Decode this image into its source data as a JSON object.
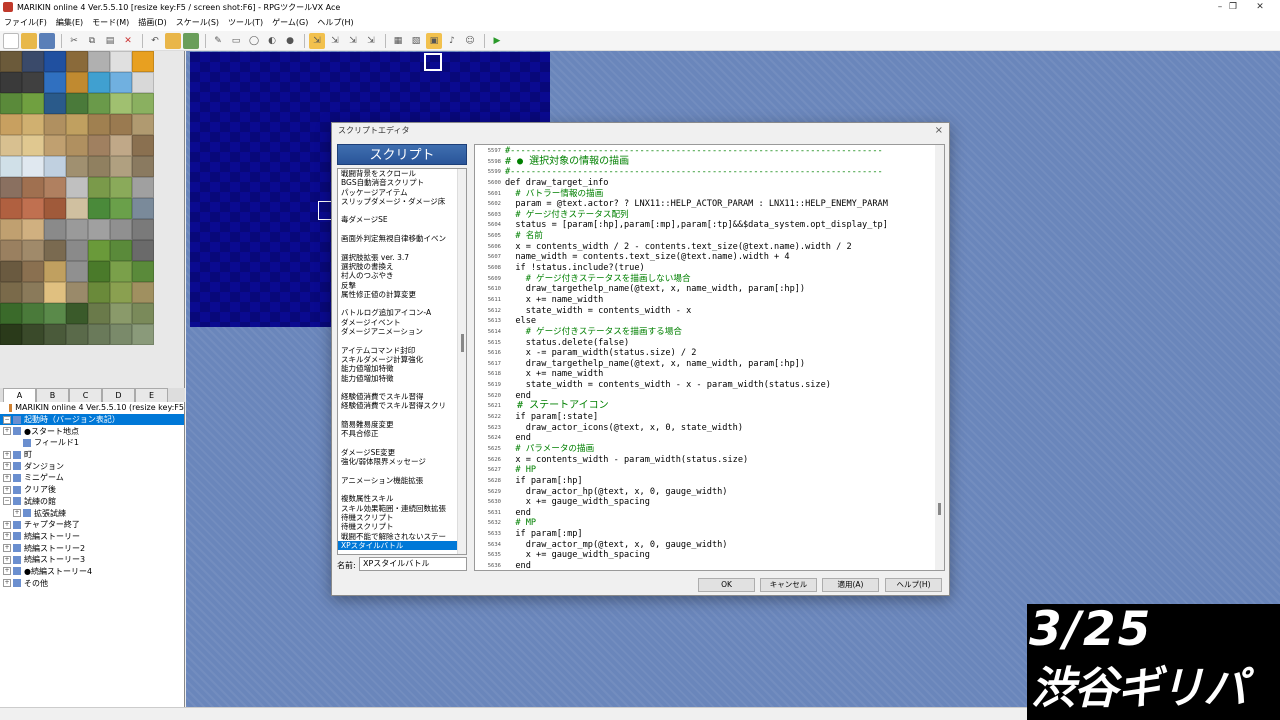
{
  "window": {
    "title": "MARIKIN online 4 Ver.5.5.10 [resize key:F5 / screen shot:F6] - RPGツクールVX Ace",
    "controls": [
      "–",
      "❐",
      "✕"
    ]
  },
  "menu": [
    "ファイル(F)",
    "編集(E)",
    "モード(M)",
    "描画(D)",
    "スケール(S)",
    "ツール(T)",
    "ゲーム(G)",
    "ヘルプ(H)"
  ],
  "map_tabs": [
    "A",
    "B",
    "C",
    "D",
    "E"
  ],
  "map_tree": [
    {
      "label": "MARIKIN online 4 Ver.5.5.10 (resize key:F5",
      "level": 0,
      "root": true,
      "exp": ""
    },
    {
      "label": "起動時（バージョン表記）",
      "level": 0,
      "selected": true,
      "exp": "−"
    },
    {
      "label": "●スタート地点",
      "level": 0,
      "exp": "+"
    },
    {
      "label": "フィールド1",
      "level": 1,
      "exp": ""
    },
    {
      "label": "町",
      "level": 0,
      "exp": "+"
    },
    {
      "label": "ダンジョン",
      "level": 0,
      "exp": "+"
    },
    {
      "label": "ミニゲーム",
      "level": 0,
      "exp": "+"
    },
    {
      "label": "クリア後",
      "level": 0,
      "exp": "+"
    },
    {
      "label": "試練の館",
      "level": 0,
      "exp": "−"
    },
    {
      "label": "拡張試練",
      "level": 1,
      "exp": "+"
    },
    {
      "label": "チャプター終了",
      "level": 0,
      "exp": "+"
    },
    {
      "label": "続編ストーリー",
      "level": 0,
      "exp": "+"
    },
    {
      "label": "続編ストーリー2",
      "level": 0,
      "exp": "+"
    },
    {
      "label": "続編ストーリー3",
      "level": 0,
      "exp": "+"
    },
    {
      "label": "●続編ストーリー4",
      "level": 0,
      "exp": "+"
    },
    {
      "label": "その他",
      "level": 0,
      "exp": "+"
    }
  ],
  "dialog": {
    "title": "スクリプトエディタ",
    "close": "×",
    "header": "スクリプト",
    "name_label": "名前:",
    "name_value": "XPスタイルバトル",
    "buttons": {
      "ok": "OK",
      "cancel": "キャンセル",
      "apply": "適用(A)",
      "help": "ヘルプ(H)"
    },
    "script_list": [
      "戦闘背景をスクロール",
      "BGS自動消音スクリプト",
      "パッケージアイテム",
      "スリップダメージ・ダメージ床",
      "",
      "毒ダメージSE",
      "",
      "画面外判定無視自律移動イベン",
      "",
      "選択肢拡張 ver. 3.7",
      "選択肢の書換え",
      "村人のつぶやき",
      "反撃",
      "属性修正値の計算変更",
      "",
      "バトルログ追加アイコン-A",
      "ダメージイベント",
      "ダメージアニメーション",
      "",
      "アイテムコマンド封印",
      "スキルダメージ計算強化",
      "能力値増加特徴",
      "能力値増加特徴",
      "",
      "経験値消費でスキル習得",
      "経験値消費でスキル習得スクリ",
      "",
      "簡易難易度変更",
      "不具合修正",
      "",
      "ダメージSE変更",
      "強化/弱体限界メッセージ",
      "",
      "アニメーション機能拡張",
      "",
      "複数属性スキル",
      "スキル効果範囲・連続回数拡張",
      "待機スクリプト",
      "待機スクリプト",
      "戦闘不能で解除されないステー",
      "XPスタイルバトル"
    ],
    "selected_script": "XPスタイルバトル",
    "code": [
      {
        "n": "5597",
        "t": "#------------------------------------------------------------------------",
        "c": "cm"
      },
      {
        "n": "5598",
        "t": "# ● 選択対象の情報の描画",
        "c": "cmh"
      },
      {
        "n": "5599",
        "t": "#------------------------------------------------------------------------",
        "c": "cm"
      },
      {
        "n": "5600",
        "t": "def draw_target_info",
        "c": ""
      },
      {
        "n": "5601",
        "t": "  # バトラー情報の描画",
        "c": "cm"
      },
      {
        "n": "5602",
        "t": "  param = @text.actor? ? LNX11::HELP_ACTOR_PARAM : LNX11::HELP_ENEMY_PARAM",
        "c": ""
      },
      {
        "n": "5603",
        "t": "  # ゲージ付きステータス配列",
        "c": "cm"
      },
      {
        "n": "5604",
        "t": "  status = [param[:hp],param[:mp],param[:tp]&&$data_system.opt_display_tp]",
        "c": ""
      },
      {
        "n": "5605",
        "t": "  # 名前",
        "c": "cm"
      },
      {
        "n": "5606",
        "t": "  x = contents_width / 2 - contents.text_size(@text.name).width / 2",
        "c": ""
      },
      {
        "n": "5607",
        "t": "  name_width = contents.text_size(@text.name).width + 4",
        "c": ""
      },
      {
        "n": "5608",
        "t": "  if !status.include?(true)",
        "c": ""
      },
      {
        "n": "5609",
        "t": "    # ゲージ付きステータスを描画しない場合",
        "c": "cm"
      },
      {
        "n": "5610",
        "t": "    draw_targethelp_name(@text, x, name_width, param[:hp])",
        "c": ""
      },
      {
        "n": "5611",
        "t": "    x += name_width",
        "c": ""
      },
      {
        "n": "5612",
        "t": "    state_width = contents_width - x",
        "c": ""
      },
      {
        "n": "5613",
        "t": "  else",
        "c": ""
      },
      {
        "n": "5614",
        "t": "    # ゲージ付きステータスを描画する場合",
        "c": "cm"
      },
      {
        "n": "5615",
        "t": "    status.delete(false)",
        "c": ""
      },
      {
        "n": "5616",
        "t": "    x -= param_width(status.size) / 2",
        "c": ""
      },
      {
        "n": "5617",
        "t": "    draw_targethelp_name(@text, x, name_width, param[:hp])",
        "c": ""
      },
      {
        "n": "5618",
        "t": "    x += name_width",
        "c": ""
      },
      {
        "n": "5619",
        "t": "    state_width = contents_width - x - param_width(status.size)",
        "c": ""
      },
      {
        "n": "5620",
        "t": "  end",
        "c": ""
      },
      {
        "n": "5621",
        "t": "  # ステートアイコン",
        "c": "cmh"
      },
      {
        "n": "5622",
        "t": "  if param[:state]",
        "c": ""
      },
      {
        "n": "5623",
        "t": "    draw_actor_icons(@text, x, 0, state_width)",
        "c": ""
      },
      {
        "n": "5624",
        "t": "  end",
        "c": ""
      },
      {
        "n": "5625",
        "t": "  # パラメータの描画",
        "c": "cm"
      },
      {
        "n": "5626",
        "t": "  x = contents_width - param_width(status.size)",
        "c": ""
      },
      {
        "n": "5627",
        "t": "  # HP",
        "c": "cm"
      },
      {
        "n": "5628",
        "t": "  if param[:hp]",
        "c": ""
      },
      {
        "n": "5629",
        "t": "    draw_actor_hp(@text, x, 0, gauge_width)",
        "c": ""
      },
      {
        "n": "5630",
        "t": "    x += gauge_width_spacing",
        "c": ""
      },
      {
        "n": "5631",
        "t": "  end",
        "c": ""
      },
      {
        "n": "5632",
        "t": "  # MP",
        "c": "cm"
      },
      {
        "n": "5633",
        "t": "  if param[:mp]",
        "c": ""
      },
      {
        "n": "5634",
        "t": "    draw_actor_mp(@text, x, 0, gauge_width)",
        "c": ""
      },
      {
        "n": "5635",
        "t": "    x += gauge_width_spacing",
        "c": ""
      },
      {
        "n": "5636",
        "t": "  end",
        "c": ""
      }
    ]
  },
  "overlay": {
    "date": "3/25",
    "place": "渋谷ギリパ"
  },
  "colors": {
    "selection": "#0078d7",
    "code_comment": "#008000",
    "map_background": "#6a86bb",
    "map_canvas": "#08087a",
    "script_header": "#2a5599"
  }
}
